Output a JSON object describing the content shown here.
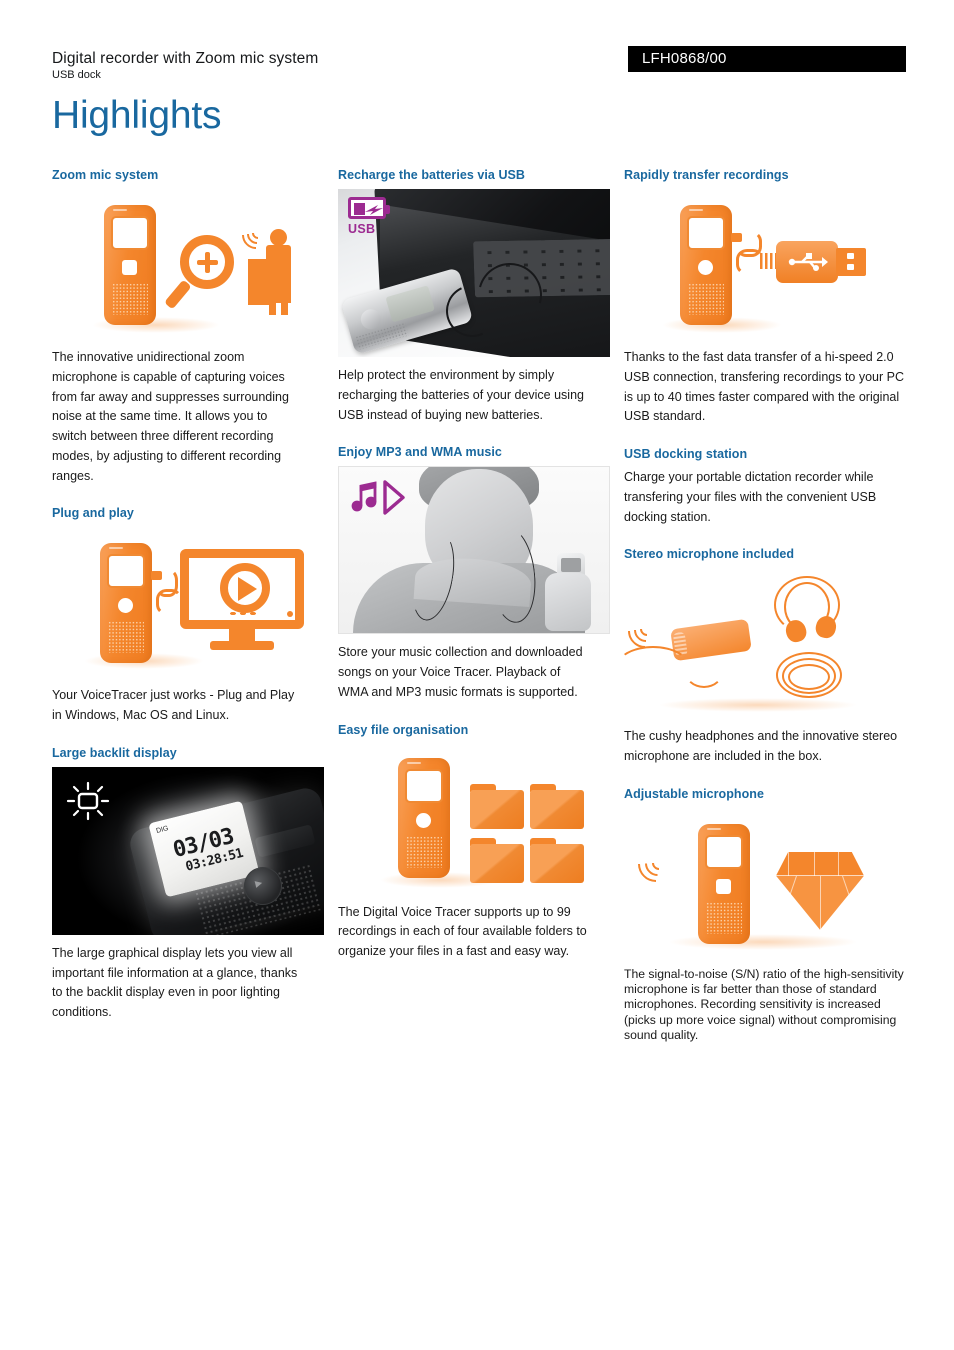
{
  "header": {
    "product_title": "Digital recorder with Zoom mic system",
    "product_subtitle": "USB dock",
    "model_code": "LFH0868/00",
    "page_title": "Highlights"
  },
  "colors": {
    "heading_blue": "#19689f",
    "accent_orange": "#f4862c",
    "icon_purple": "#9c2b91",
    "badge_background": "#000000",
    "body_text": "#1a1a1a"
  },
  "columns": [
    {
      "features": [
        {
          "title": "Zoom mic system",
          "figure": "zoom-mic-illustration",
          "body": "The innovative unidirectional zoom microphone is capable of capturing voices from far away and suppresses surrounding noise at the same time. It allows you to switch between three different recording modes, by adjusting to different recording ranges."
        },
        {
          "title": "Plug and play",
          "figure": "recorder-monitor-illustration",
          "body": "Your VoiceTracer just works - Plug and Play in Windows, Mac OS and Linux."
        },
        {
          "title": "Large backlit display",
          "figure": "backlit-display-photo",
          "display_date": "03/03",
          "display_time": "03:28:51",
          "display_small": "DIG",
          "body": "The large graphical display lets you view all important file information at a glance, thanks to the backlit display even in poor lighting conditions."
        }
      ]
    },
    {
      "features": [
        {
          "title": "Recharge the batteries via USB",
          "figure": "recorder-laptop-photo",
          "icon_label": "USB",
          "body": "Help protect the environment by simply recharging the batteries of your device using USB instead of buying new batteries."
        },
        {
          "title": "Enjoy MP3 and WMA music",
          "figure": "man-with-earphones-illustration",
          "body": "Store your music collection and downloaded songs on your Voice Tracer. Playback of WMA and MP3 music formats is supported."
        },
        {
          "title": "Easy file organisation",
          "figure": "recorder-folders-illustration",
          "body": "The Digital Voice Tracer supports up to 99 recordings in each of four available folders to organize your files in a fast and easy way."
        }
      ]
    },
    {
      "features": [
        {
          "title": "Rapidly transfer recordings",
          "figure": "recorder-usb-plug-illustration",
          "body": "Thanks to the fast data transfer of a hi-speed 2.0 USB connection, transfering recordings to your PC is up to 40 times faster compared with the original USB standard."
        },
        {
          "title": "USB docking station",
          "figure": null,
          "body": "Charge your portable dictation recorder while transfering your files with the convenient USB docking station."
        },
        {
          "title": "Stereo microphone included",
          "figure": "stereo-mic-earbuds-illustration",
          "body": "The cushy headphones and the innovative stereo microphone are included in the box."
        },
        {
          "title": "Adjustable microphone",
          "figure": "recorder-diamond-illustration",
          "body": "The signal-to-noise (S/N) ratio of the high-sensitivity microphone is far better than those of standard microphones. Recording sensitivity is increased (picks up more voice signal) without compromising sound quality."
        }
      ]
    }
  ]
}
